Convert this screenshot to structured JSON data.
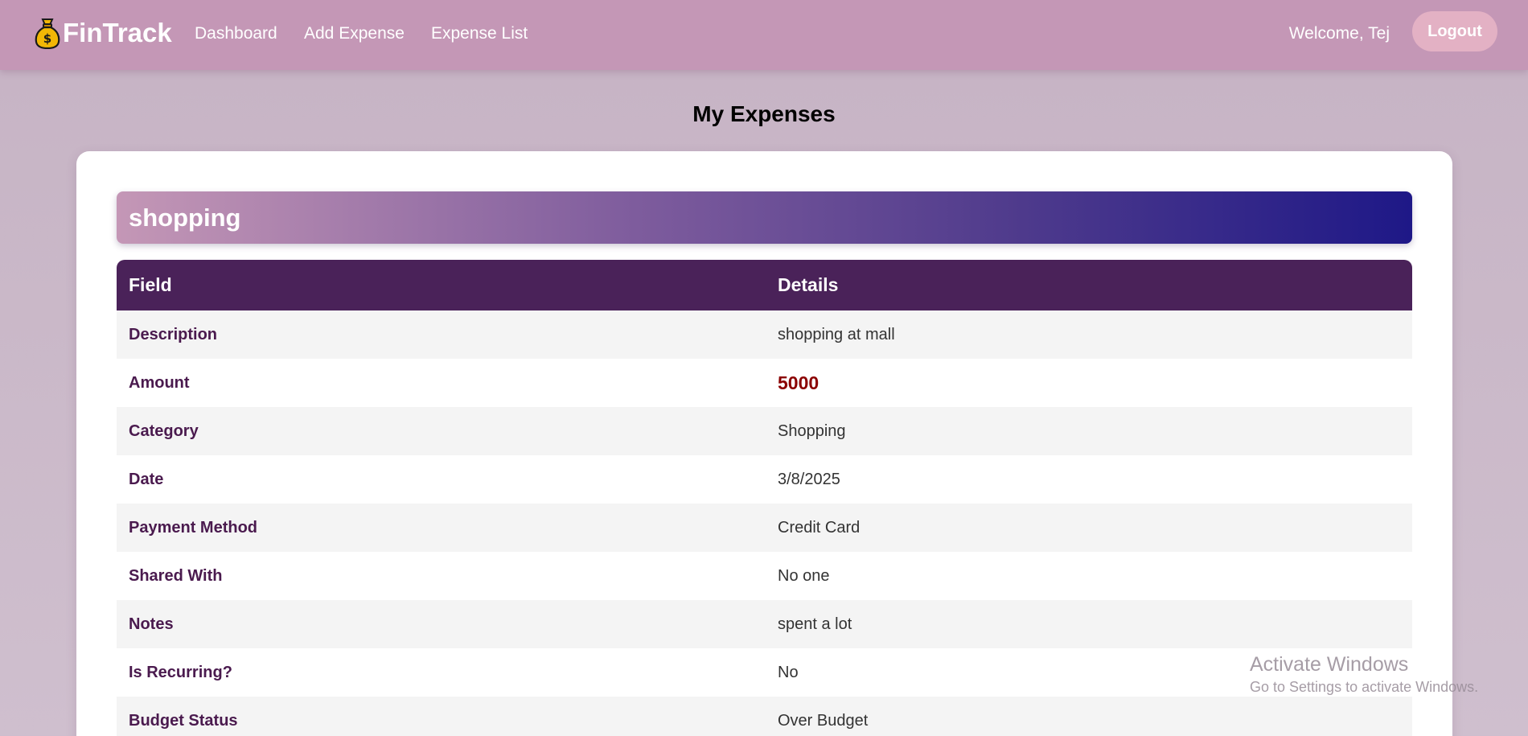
{
  "navbar": {
    "brand": "FinTrack",
    "brand_icon": "money-bag-icon",
    "links": [
      "Dashboard",
      "Add Expense",
      "Expense List"
    ],
    "welcome": "Welcome, Tej",
    "logout_label": "Logout",
    "colors": {
      "background": "#c497b6",
      "logout_background": "#e3b1c4"
    }
  },
  "page": {
    "title": "My Expenses"
  },
  "expense": {
    "title": "shopping",
    "table": {
      "headers": [
        "Field",
        "Details"
      ],
      "rows": [
        {
          "field": "Description",
          "value": "shopping at mall"
        },
        {
          "field": "Amount",
          "value": "5000"
        },
        {
          "field": "Category",
          "value": "Shopping"
        },
        {
          "field": "Date",
          "value": "3/8/2025"
        },
        {
          "field": "Payment Method",
          "value": "Credit Card"
        },
        {
          "field": "Shared With",
          "value": "No one"
        },
        {
          "field": "Notes",
          "value": "spent a lot"
        },
        {
          "field": "Is Recurring?",
          "value": "No"
        },
        {
          "field": "Budget Status",
          "value": "Over Budget"
        }
      ]
    },
    "colors": {
      "table_header": "#4a2259",
      "field_text": "#4a1a4e",
      "amount_text": "#8b0000"
    }
  },
  "watermark": {
    "title": "Activate Windows",
    "subtitle": "Go to Settings to activate Windows."
  }
}
